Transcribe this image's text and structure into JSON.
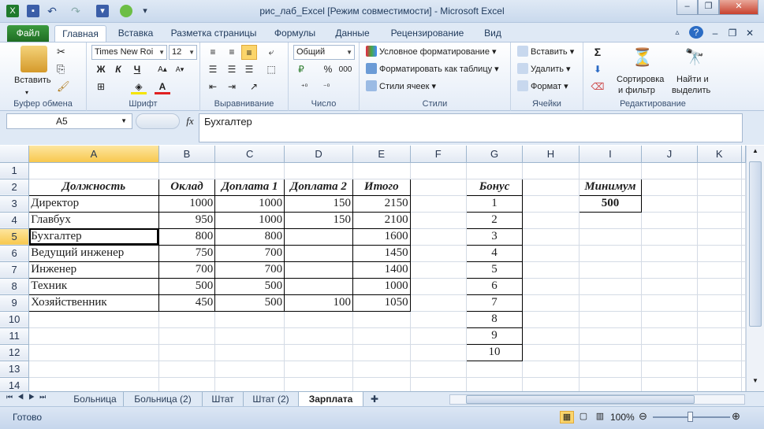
{
  "window": {
    "title": "рис_лаб_Excel  [Режим совместимости]  -  Microsoft Excel",
    "controls": [
      "–",
      "❐",
      "✕"
    ]
  },
  "ribbon_tabs": [
    "Файл",
    "Главная",
    "Вставка",
    "Разметка страницы",
    "Формулы",
    "Данные",
    "Рецензирование",
    "Вид"
  ],
  "groups": {
    "clipboard": {
      "label": "Буфер обмена",
      "paste": "Вставить"
    },
    "font": {
      "label": "Шрифт",
      "name": "Times New Roi",
      "size": "12",
      "bold": "Ж",
      "italic": "К",
      "underline": "Ч"
    },
    "alignment": {
      "label": "Выравнивание"
    },
    "number": {
      "label": "Число",
      "format": "Общий",
      "percent": "%",
      "thousands": "000"
    },
    "styles": {
      "label": "Стили",
      "cond": "Условное форматирование",
      "table": "Форматировать как таблицу",
      "cell": "Стили ячеек"
    },
    "cells": {
      "label": "Ячейки",
      "insert": "Вставить",
      "delete": "Удалить",
      "format": "Формат"
    },
    "editing": {
      "label": "Редактирование",
      "sort1": "Сортировка",
      "sort2": "и фильтр",
      "find1": "Найти и",
      "find2": "выделить",
      "sigma": "Σ"
    }
  },
  "formula_bar": {
    "name_box": "A5",
    "fx": "fx",
    "content": "Бухгалтер"
  },
  "sheet": {
    "columns": [
      "A",
      "B",
      "C",
      "D",
      "E",
      "F",
      "G",
      "H",
      "I",
      "J",
      "K"
    ],
    "rows": [
      "1",
      "2",
      "3",
      "4",
      "5",
      "6",
      "7",
      "8",
      "9",
      "10",
      "11",
      "12",
      "13",
      "14"
    ],
    "headers": [
      "Должность",
      "Оклад",
      "Доплата 1",
      "Доплата 2",
      "Итого"
    ],
    "data": [
      [
        "Директор",
        "1000",
        "1000",
        "150",
        "2150"
      ],
      [
        "Главбух",
        "950",
        "1000",
        "150",
        "2100"
      ],
      [
        "Бухгалтер",
        "800",
        "800",
        "",
        "1600"
      ],
      [
        "Ведущий инженер",
        "750",
        "700",
        "",
        "1450"
      ],
      [
        "Инженер",
        "700",
        "700",
        "",
        "1400"
      ],
      [
        "Техник",
        "500",
        "500",
        "",
        "1000"
      ],
      [
        "Хозяйственник",
        "450",
        "500",
        "100",
        "1050"
      ]
    ],
    "bonus_header": "Бонус",
    "bonus": [
      "1",
      "2",
      "3",
      "4",
      "5",
      "6",
      "7",
      "8",
      "9",
      "10"
    ],
    "min_header": "Минимум",
    "min_value": "500"
  },
  "sheet_tabs": [
    "Больница",
    "Больница (2)",
    "Штат",
    "Штат (2)",
    "Зарплата"
  ],
  "active_tab": "Зарплата",
  "status": {
    "ready": "Готово",
    "zoom": "100%"
  }
}
